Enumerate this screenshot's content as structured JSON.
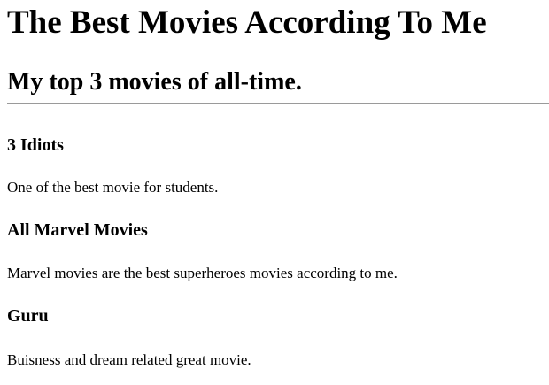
{
  "page": {
    "title": "The Best Movies According To Me",
    "subtitle": "My top 3 movies of all-time."
  },
  "movies": [
    {
      "title": "3 Idiots",
      "description": "One of the best movie for students."
    },
    {
      "title": "All Marvel Movies",
      "description": "Marvel movies are the best superheroes movies according to me."
    },
    {
      "title": "Guru",
      "description": "Buisness and dream related great movie."
    }
  ]
}
